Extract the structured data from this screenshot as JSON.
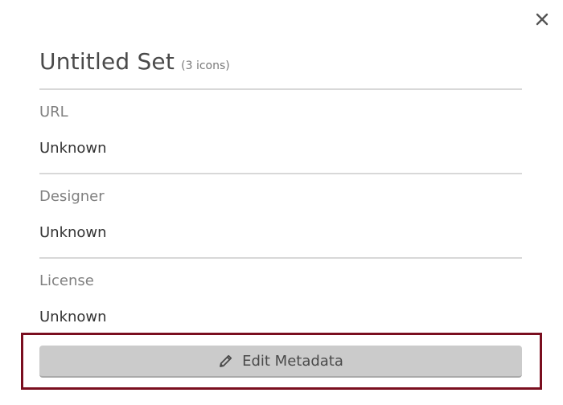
{
  "dialog": {
    "title": "Untitled Set",
    "icon_count": "(3 icons)",
    "close_icon": "close-icon"
  },
  "fields": [
    {
      "label": "URL",
      "value": "Unknown"
    },
    {
      "label": "Designer",
      "value": "Unknown"
    },
    {
      "label": "License",
      "value": "Unknown"
    }
  ],
  "actions": {
    "edit_label": "Edit Metadata",
    "edit_icon": "pencil-icon"
  },
  "colors": {
    "highlight": "#7a0e1f",
    "button_bg": "#cbcbcb"
  }
}
